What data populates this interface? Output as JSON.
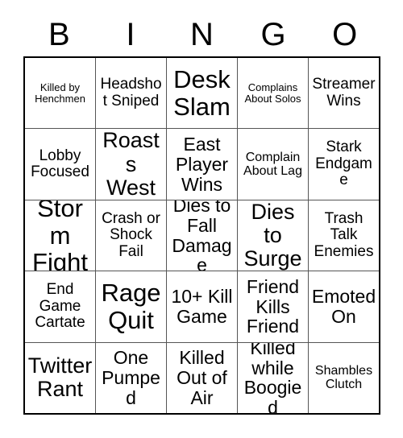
{
  "header": {
    "letters": [
      "B",
      "I",
      "N",
      "G",
      "O"
    ]
  },
  "grid": {
    "rows": 5,
    "columns": 5,
    "cells": [
      [
        {
          "text": "Killed by Henchmen",
          "size": "xs"
        },
        {
          "text": "Headshot Sniped",
          "size": "md"
        },
        {
          "text": "Desk Slam",
          "size": "xxl"
        },
        {
          "text": "Complains About Solos",
          "size": "xs"
        },
        {
          "text": "Streamer Wins",
          "size": "md"
        }
      ],
      [
        {
          "text": "Lobby Focused",
          "size": "md"
        },
        {
          "text": "Roasts West",
          "size": "xl"
        },
        {
          "text": "East Player Wins",
          "size": "lg"
        },
        {
          "text": "Complain About Lag",
          "size": "sm"
        },
        {
          "text": "Stark Endgame",
          "size": "md"
        }
      ],
      [
        {
          "text": "Storm Fight",
          "size": "xxl"
        },
        {
          "text": "Crash or Shock Fail",
          "size": "md"
        },
        {
          "text": "Dies to Fall Damage",
          "size": "lg"
        },
        {
          "text": "Dies to Surge",
          "size": "xl"
        },
        {
          "text": "Trash Talk Enemies",
          "size": "md"
        }
      ],
      [
        {
          "text": "End Game Cartate",
          "size": "md"
        },
        {
          "text": "Rage Quit",
          "size": "xxl"
        },
        {
          "text": "10+ Kill Game",
          "size": "lg"
        },
        {
          "text": "Friend Kills Friend",
          "size": "lg"
        },
        {
          "text": "Emoted On",
          "size": "lg"
        }
      ],
      [
        {
          "text": "Twitter Rant",
          "size": "xl"
        },
        {
          "text": "One Pumped",
          "size": "lg"
        },
        {
          "text": "Killed Out of Air",
          "size": "lg"
        },
        {
          "text": "Killed while Boogied",
          "size": "lg"
        },
        {
          "text": "Shambles Clutch",
          "size": "sm"
        }
      ]
    ]
  },
  "colors": {
    "background": "#ffffff",
    "text": "#000000",
    "outer_border": "#000000",
    "inner_border": "#555555"
  }
}
